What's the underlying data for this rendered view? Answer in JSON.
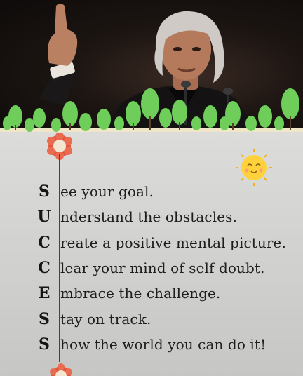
{
  "acrostic": {
    "rows": [
      {
        "letter": "S",
        "text": "ee your goal."
      },
      {
        "letter": "U",
        "text": "nderstand the obstacles."
      },
      {
        "letter": "C",
        "text": "reate a positive mental picture."
      },
      {
        "letter": "C",
        "text": "lear your mind of self doubt."
      },
      {
        "letter": "E",
        "text": "mbrace the challenge."
      },
      {
        "letter": "S",
        "text": "tay on track."
      },
      {
        "letter": "S",
        "text": "how the world you can do it!"
      }
    ]
  },
  "colors": {
    "card_bg": "#d4d4d2",
    "tree_green": "#6fce5a",
    "flower_red": "#e2553f",
    "sun_yellow": "#ffd23c"
  }
}
